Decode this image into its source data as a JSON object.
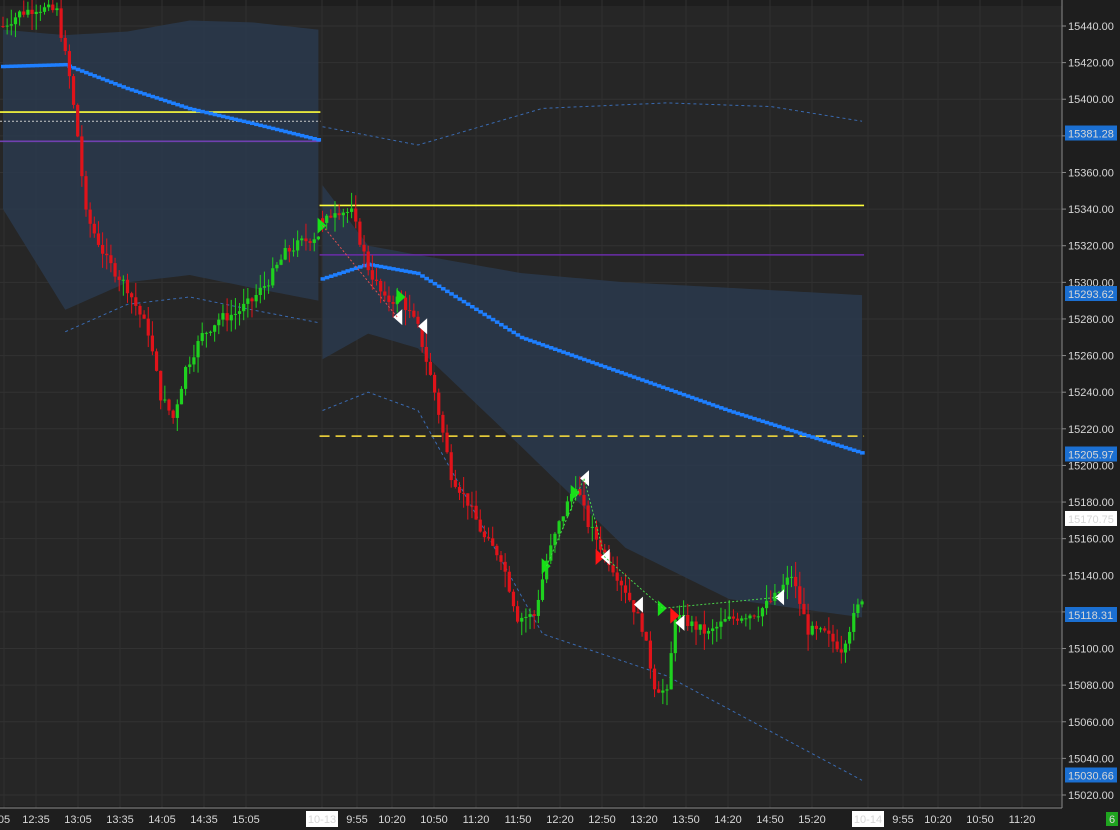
{
  "chart_data": {
    "type": "candlestick",
    "y_axis": {
      "range": [
        15010,
        15450
      ],
      "ticks": [
        15440,
        15420,
        15400,
        15380,
        15360,
        15340,
        15320,
        15300,
        15280,
        15260,
        15240,
        15220,
        15200,
        15180,
        15160,
        15140,
        15120,
        15100,
        15080,
        15060,
        15040,
        15020
      ],
      "tick_labels": [
        "15440.00",
        "15420.00",
        "15400.00",
        "15380.00",
        "15360.00",
        "15340.00",
        "15320.00",
        "15300.00",
        "15280.00",
        "15260.00",
        "15240.00",
        "15220.00",
        "15200.00",
        "15180.00",
        "15160.00",
        "15140.00",
        "15120.00",
        "15100.00",
        "15080.00",
        "15060.00",
        "15040.00",
        "15020.00"
      ],
      "tags": [
        {
          "value": 15381.28,
          "label": "15381.28",
          "kind": "blue"
        },
        {
          "value": 15293.62,
          "label": "15293.62",
          "kind": "blue"
        },
        {
          "value": 15205.97,
          "label": "15205.97",
          "kind": "blue"
        },
        {
          "value": 15170.75,
          "label": "15170.75",
          "kind": "white"
        },
        {
          "value": 15118.31,
          "label": "15118.31",
          "kind": "blue"
        },
        {
          "value": 15030.66,
          "label": "15030.66",
          "kind": "blue"
        }
      ]
    },
    "x_axis": {
      "labels": [
        "05",
        "12:35",
        "13:05",
        "13:35",
        "14:05",
        "14:35",
        "15:05",
        "10-13",
        "9:55",
        "10:20",
        "10:50",
        "11:20",
        "11:50",
        "12:20",
        "12:50",
        "13:20",
        "13:50",
        "14:20",
        "14:50",
        "15:20",
        "10-14",
        "9:55",
        "10:20",
        "10:50",
        "11:20"
      ],
      "highlighted": [
        "10-13",
        "10-14"
      ]
    },
    "horizontal_lines": [
      {
        "value": 15393,
        "from_bar": 0,
        "to_bar": 76,
        "color": "#ffff3c",
        "style": "solid"
      },
      {
        "value": 15388,
        "from_bar": 0,
        "to_bar": 76,
        "color": "#c8c8c8",
        "style": "dotted"
      },
      {
        "value": 15377,
        "from_bar": 0,
        "to_bar": 76,
        "color": "#7040b0",
        "style": "solid"
      },
      {
        "value": 15342,
        "from_bar": 77,
        "to_bar": 207,
        "color": "#ffff3c",
        "style": "solid"
      },
      {
        "value": 15315,
        "from_bar": 77,
        "to_bar": 207,
        "color": "#6a2ca8",
        "style": "solid"
      },
      {
        "value": 15216,
        "from_bar": 77,
        "to_bar": 207,
        "color": "#ffe23c",
        "style": "dashed"
      }
    ],
    "vwap_sessions": [
      {
        "name": "day1",
        "bars": [
          0,
          15,
          30,
          45,
          60,
          76
        ],
        "vwap": [
          15418,
          15419,
          15406,
          15395,
          15387,
          15378
        ],
        "band_upper": [
          15438,
          15435,
          15437,
          15443,
          15442,
          15438
        ],
        "band_lower": [
          15340,
          15285,
          15300,
          15304,
          15297,
          15290
        ]
      },
      {
        "name": "day2",
        "bars": [
          77,
          88,
          100,
          125,
          150,
          175,
          207
        ],
        "vwap": [
          15302,
          15310,
          15305,
          15270,
          15250,
          15230,
          15207
        ],
        "band_upper": [
          15353,
          15320,
          15315,
          15305,
          15300,
          15297,
          15293
        ],
        "band_lower": [
          15258,
          15272,
          15264,
          15210,
          15155,
          15127,
          15117
        ],
        "sd2_upper": [
          15385,
          15375,
          15395,
          15398,
          15396,
          15388
        ],
        "sd2_upper_bars": [
          77,
          100,
          130,
          160,
          185,
          207
        ],
        "sd2_lower": [
          15230,
          15240,
          15230,
          15108,
          15085,
          15028
        ],
        "sd2_lower_bars": [
          77,
          88,
          100,
          130,
          160,
          207
        ]
      }
    ],
    "signal_markers": [
      {
        "bar": 77,
        "price": 15331,
        "kind": "buy"
      },
      {
        "bar": 95,
        "price": 15281,
        "kind": "sell"
      },
      {
        "bar": 96,
        "price": 15292,
        "kind": "buy"
      },
      {
        "bar": 101,
        "price": 15276,
        "kind": "sell"
      },
      {
        "bar": 131,
        "price": 15145,
        "kind": "buy"
      },
      {
        "bar": 138,
        "price": 15185,
        "kind": "buy"
      },
      {
        "bar": 140,
        "price": 15193,
        "kind": "sell"
      },
      {
        "bar": 144,
        "price": 15150,
        "kind": "buy-red"
      },
      {
        "bar": 145,
        "price": 15150,
        "kind": "sell"
      },
      {
        "bar": 153,
        "price": 15124,
        "kind": "sell"
      },
      {
        "bar": 159,
        "price": 15122,
        "kind": "buy"
      },
      {
        "bar": 162,
        "price": 15118,
        "kind": "buy-red"
      },
      {
        "bar": 163,
        "price": 15114,
        "kind": "sell"
      },
      {
        "bar": 187,
        "price": 15128,
        "kind": "sell"
      }
    ],
    "price_path": [
      [
        0,
        15440
      ],
      [
        4,
        15447
      ],
      [
        8,
        15450
      ],
      [
        13,
        15448
      ],
      [
        16,
        15412
      ],
      [
        18,
        15380
      ],
      [
        20,
        15337
      ],
      [
        25,
        15312
      ],
      [
        30,
        15297
      ],
      [
        35,
        15273
      ],
      [
        38,
        15238
      ],
      [
        41,
        15226
      ],
      [
        44,
        15253
      ],
      [
        48,
        15271
      ],
      [
        52,
        15280
      ],
      [
        56,
        15283
      ],
      [
        60,
        15290
      ],
      [
        64,
        15301
      ],
      [
        68,
        15316
      ],
      [
        72,
        15322
      ],
      [
        76,
        15326
      ],
      [
        77,
        15331
      ],
      [
        80,
        15340
      ],
      [
        84,
        15338
      ],
      [
        88,
        15308
      ],
      [
        92,
        15290
      ],
      [
        96,
        15291
      ],
      [
        100,
        15275
      ],
      [
        104,
        15240
      ],
      [
        108,
        15195
      ],
      [
        112,
        15180
      ],
      [
        116,
        15160
      ],
      [
        120,
        15150
      ],
      [
        124,
        15117
      ],
      [
        128,
        15118
      ],
      [
        131,
        15148
      ],
      [
        134,
        15168
      ],
      [
        138,
        15190
      ],
      [
        141,
        15168
      ],
      [
        145,
        15152
      ],
      [
        150,
        15132
      ],
      [
        154,
        15112
      ],
      [
        157,
        15080
      ],
      [
        160,
        15075
      ],
      [
        162,
        15118
      ],
      [
        166,
        15113
      ],
      [
        170,
        15108
      ],
      [
        174,
        15115
      ],
      [
        178,
        15118
      ],
      [
        182,
        15120
      ],
      [
        186,
        15128
      ],
      [
        190,
        15140
      ],
      [
        194,
        15110
      ],
      [
        198,
        15108
      ],
      [
        202,
        15100
      ],
      [
        205,
        15117
      ],
      [
        207,
        15128
      ]
    ],
    "bar_count": 208,
    "session_break_bar": 77
  }
}
